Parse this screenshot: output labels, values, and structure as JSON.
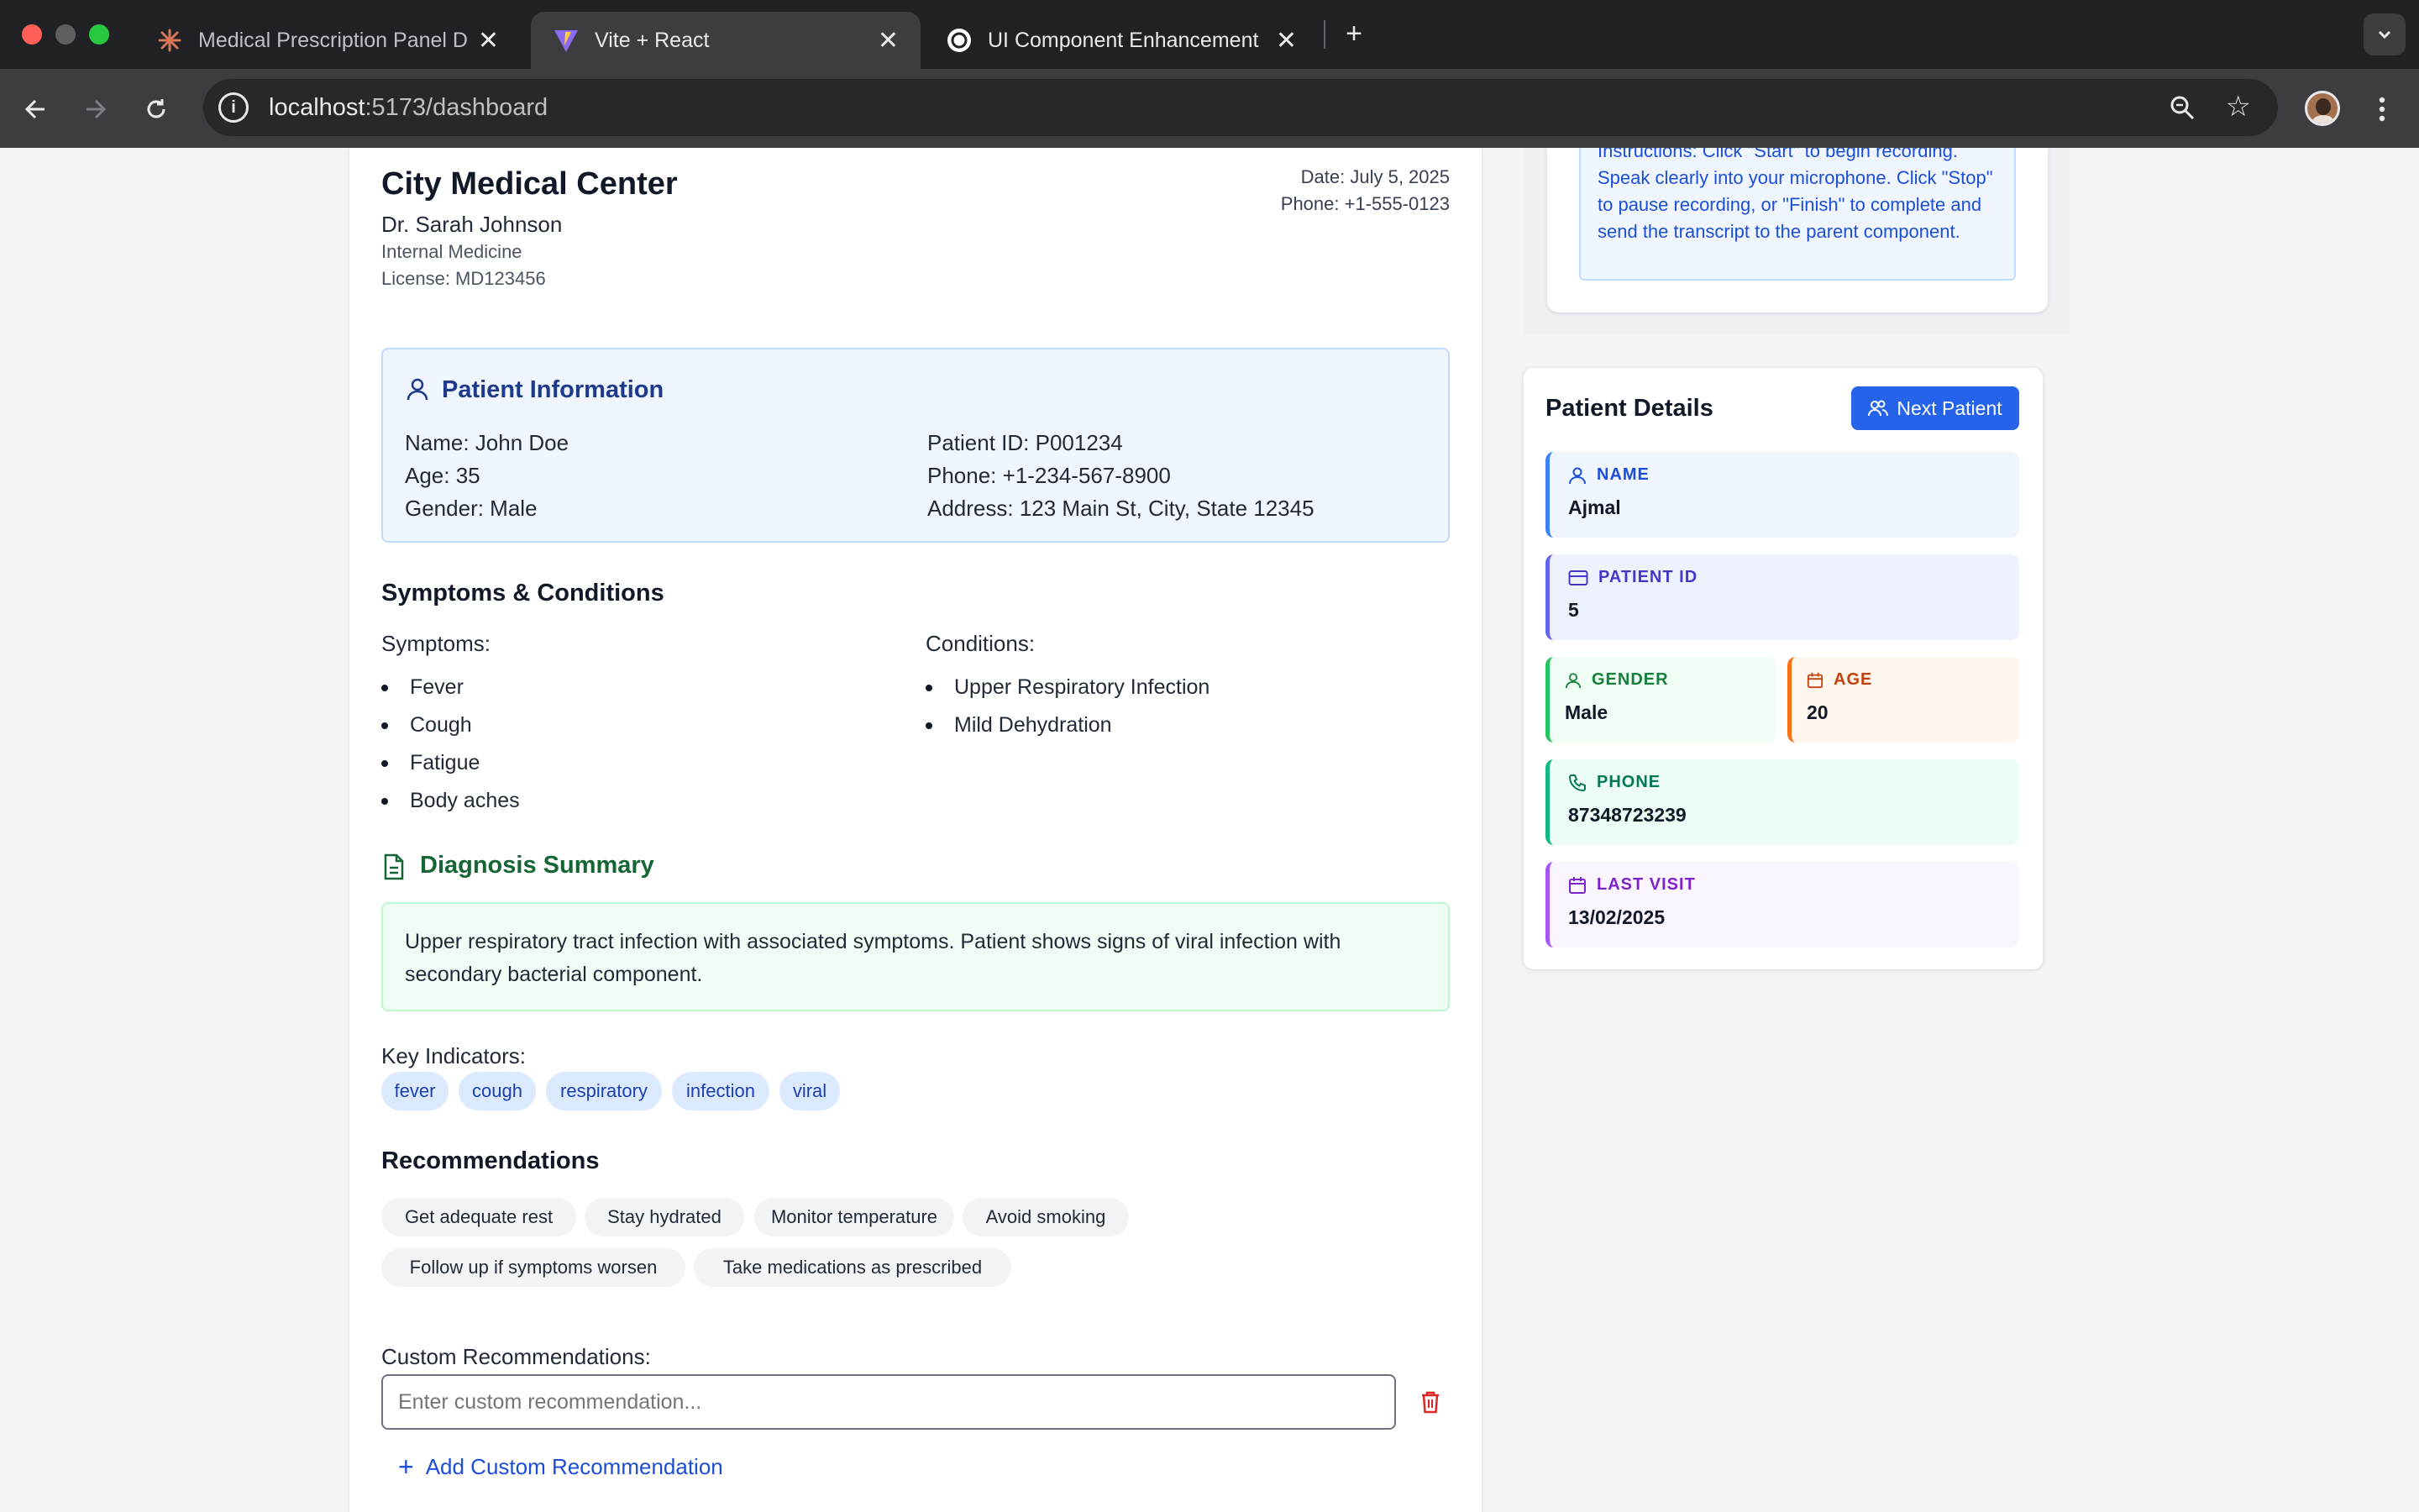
{
  "browser": {
    "tabs": [
      {
        "title": "Medical Prescription Panel De",
        "active": false,
        "icon": "claude-icon"
      },
      {
        "title": "Vite + React",
        "active": true,
        "icon": "vite-icon"
      },
      {
        "title": "UI Component Enhancement",
        "active": false,
        "icon": "openai-icon"
      }
    ],
    "url_host": "localhost",
    "url_rest": ":5173/dashboard"
  },
  "header": {
    "hospital_name": "City Medical Center",
    "doctor_name": "Dr. Sarah Johnson",
    "specialty": "Internal Medicine",
    "license": "License: MD123456",
    "date": "Date: July 5, 2025",
    "phone": "Phone: +1-555-0123"
  },
  "patient_info": {
    "title": "Patient Information",
    "name": "Name: John Doe",
    "age": "Age: 35",
    "gender": "Gender: Male",
    "patient_id": "Patient ID: P001234",
    "phone": "Phone: +1-234-567-8900",
    "address": "Address: 123 Main St, City, State 12345"
  },
  "symptoms_conditions": {
    "title": "Symptoms & Conditions",
    "symptoms_label": "Symptoms:",
    "symptoms": [
      "Fever",
      "Cough",
      "Fatigue",
      "Body aches"
    ],
    "conditions_label": "Conditions:",
    "conditions": [
      "Upper Respiratory Infection",
      "Mild Dehydration"
    ]
  },
  "diagnosis": {
    "title": "Diagnosis Summary",
    "text": "Upper respiratory tract infection with associated symptoms. Patient shows signs of viral infection with secondary bacterial component.",
    "key_indicators_label": "Key Indicators:",
    "key_indicators": [
      "fever",
      "cough",
      "respiratory",
      "infection",
      "viral"
    ]
  },
  "recommendations": {
    "title": "Recommendations",
    "items": [
      "Get adequate rest",
      "Stay hydrated",
      "Monitor temperature",
      "Avoid smoking",
      "Follow up if symptoms worsen",
      "Take medications as prescribed"
    ],
    "custom_label": "Custom Recommendations:",
    "custom_placeholder": "Enter custom recommendation...",
    "add_label": "Add Custom Recommendation"
  },
  "instructions": {
    "text_partial": "Instructions: Click \"Start\" to begin recording. Speak clearly into your microphone. Click \"Stop\" to pause recording, or \"Finish\" to complete and send the transcript to the parent component."
  },
  "patient_details": {
    "title": "Patient Details",
    "next_button": "Next Patient",
    "name_label": "NAME",
    "name": "Ajmal",
    "id_label": "PATIENT ID",
    "id": "5",
    "gender_label": "GENDER",
    "gender": "Male",
    "age_label": "AGE",
    "age": "20",
    "phone_label": "PHONE",
    "phone": "87348723239",
    "last_visit_label": "LAST VISIT",
    "last_visit": "13/02/2025"
  },
  "colors": {
    "accent_blue": "#2563eb",
    "patient_info_bg": "#eff6ff",
    "diagnosis_green": "#166534"
  }
}
